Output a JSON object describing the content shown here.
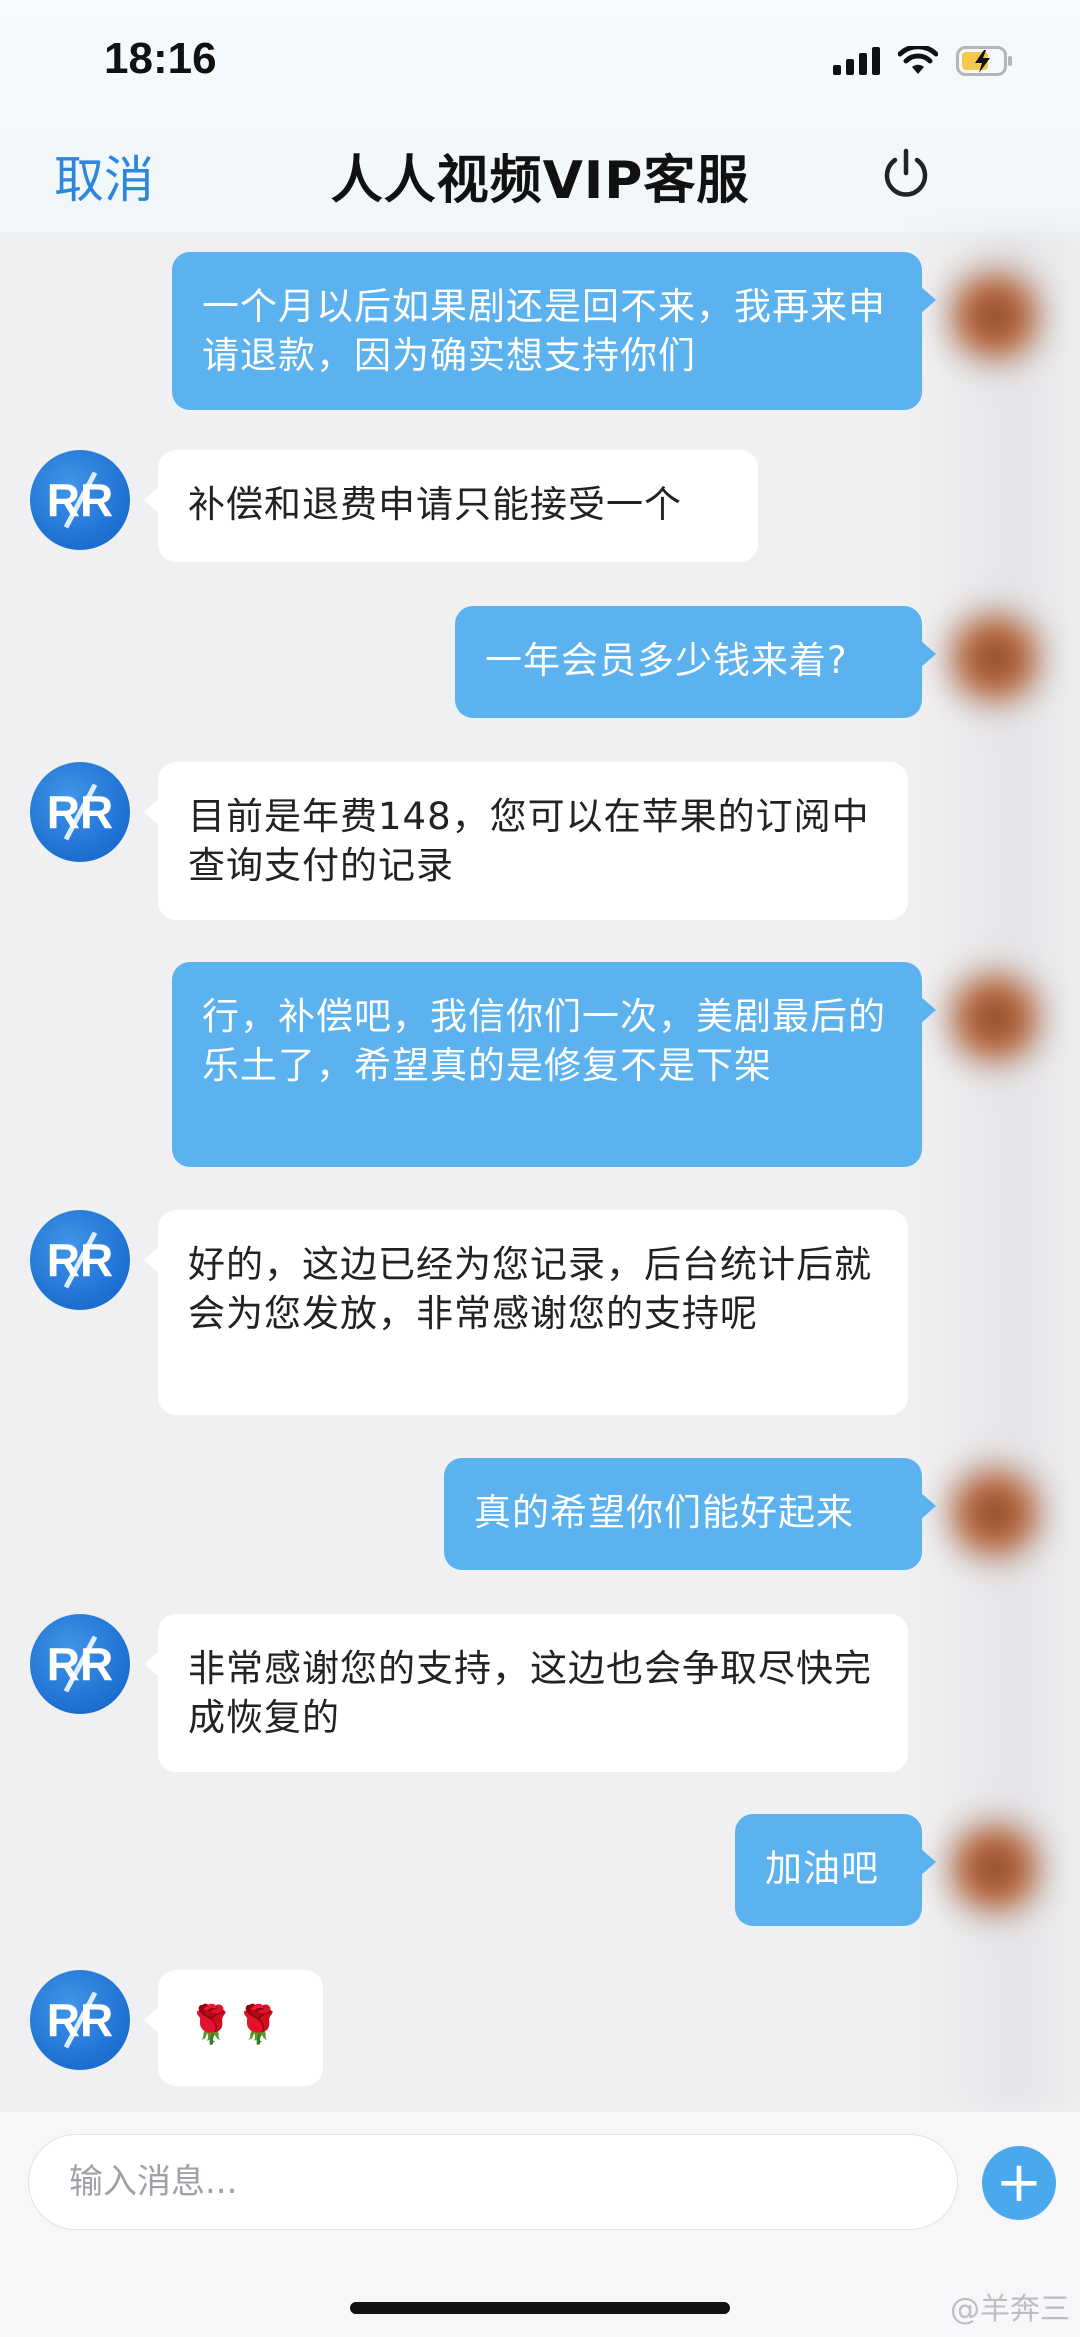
{
  "status_bar": {
    "time": "18:16"
  },
  "header": {
    "cancel_label": "取消",
    "title": "人人视频VIP客服"
  },
  "messages": [
    {
      "sender": "user",
      "text": "一个月以后如果剧还是回不来，我再来申请退款，因为确实想支持你们"
    },
    {
      "sender": "agent",
      "avatar_text": "RR",
      "text": "补偿和退费申请只能接受一个"
    },
    {
      "sender": "user",
      "text": "一年会员多少钱来着?"
    },
    {
      "sender": "agent",
      "avatar_text": "RR",
      "text": "目前是年费148，您可以在苹果的订阅中查询支付的记录"
    },
    {
      "sender": "user",
      "text": "行，补偿吧，我信你们一次，美剧最后的乐土了，希望真的是修复不是下架"
    },
    {
      "sender": "agent",
      "avatar_text": "RR",
      "text": "好的，这边已经为您记录，后台统计后就会为您发放，非常感谢您的支持呢"
    },
    {
      "sender": "user",
      "text": "真的希望你们能好起来"
    },
    {
      "sender": "agent",
      "avatar_text": "RR",
      "text": "非常感谢您的支持，这边也会争取尽快完成恢复的"
    },
    {
      "sender": "user",
      "text": "加油吧"
    },
    {
      "sender": "agent",
      "avatar_text": "RR",
      "text": "🌹🌹"
    }
  ],
  "input": {
    "placeholder": "输入消息...",
    "add_label": "+"
  },
  "watermark": "@羊奔三",
  "colors": {
    "accent": "#2d86de",
    "user_bubble": "#5bb2ef",
    "agent_bubble": "#ffffff",
    "background": "#f0f0f2"
  }
}
